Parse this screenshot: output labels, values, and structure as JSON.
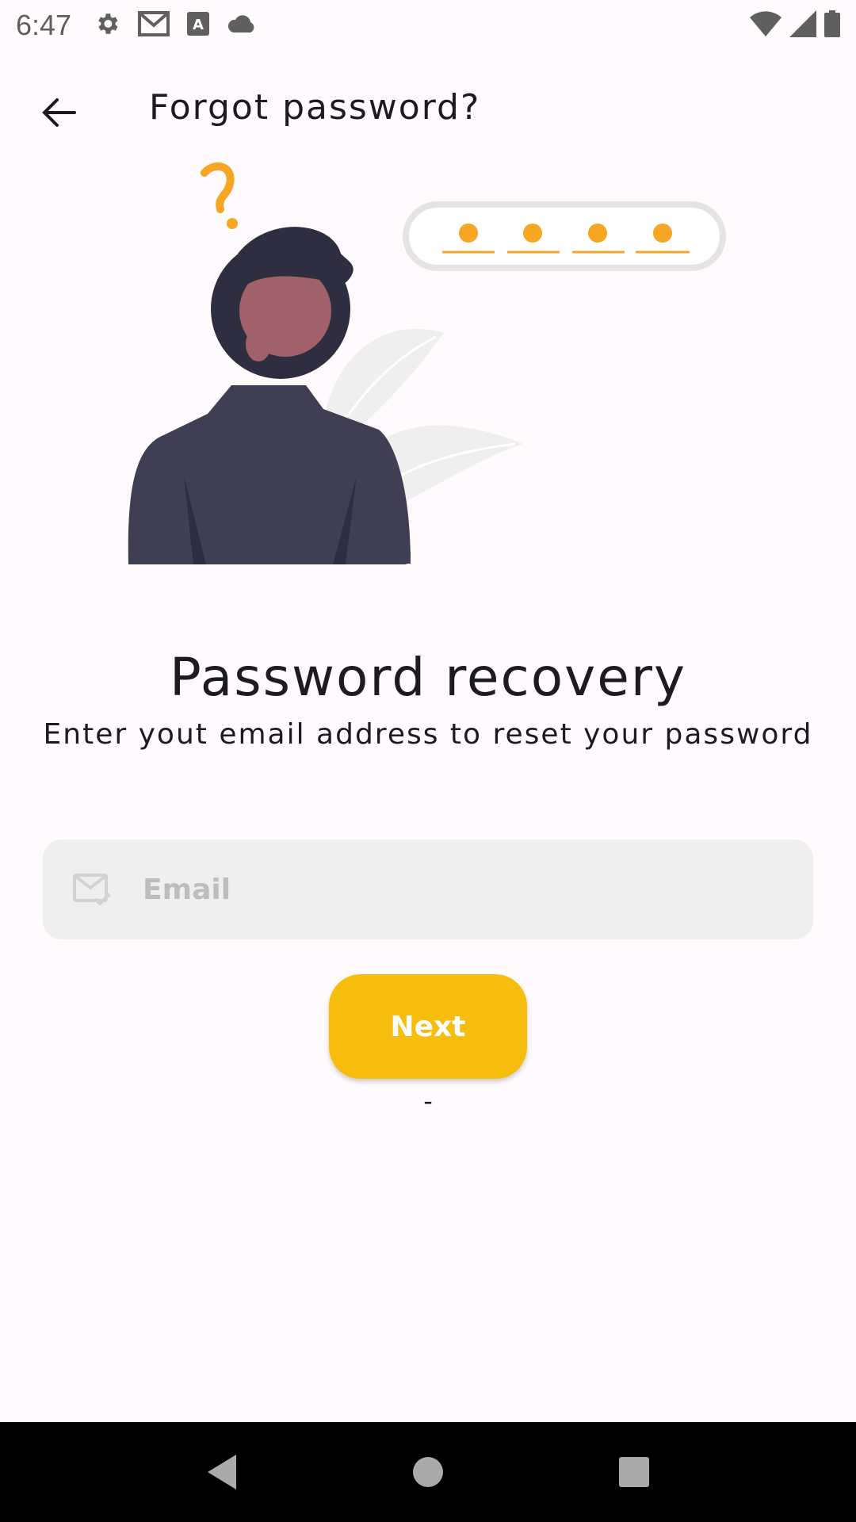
{
  "status_bar": {
    "time": "6:47",
    "icons": [
      "settings-icon",
      "gmail-icon",
      "keyboard-icon",
      "cloud-icon"
    ],
    "right_icons": [
      "wifi-icon",
      "signal-icon",
      "battery-icon"
    ]
  },
  "app_bar": {
    "title": "Forgot password?",
    "back_icon": "arrow-back-icon"
  },
  "illustration": {
    "accent": "#f6a623",
    "pin_dots": 4
  },
  "main": {
    "heading": "Password recovery",
    "subheading": "Enter yout email address to reset your password",
    "email": {
      "placeholder": "Email",
      "value": "",
      "icon": "mail-check-icon"
    },
    "next_label": "Next",
    "dash": "-"
  },
  "nav_bar": {
    "buttons": [
      "back-triangle-icon",
      "home-circle-icon",
      "recents-square-icon"
    ]
  },
  "colors": {
    "background": "#fffafd",
    "button": "#f6bd0d",
    "field": "#efefef",
    "text": "#1c1b1f"
  }
}
